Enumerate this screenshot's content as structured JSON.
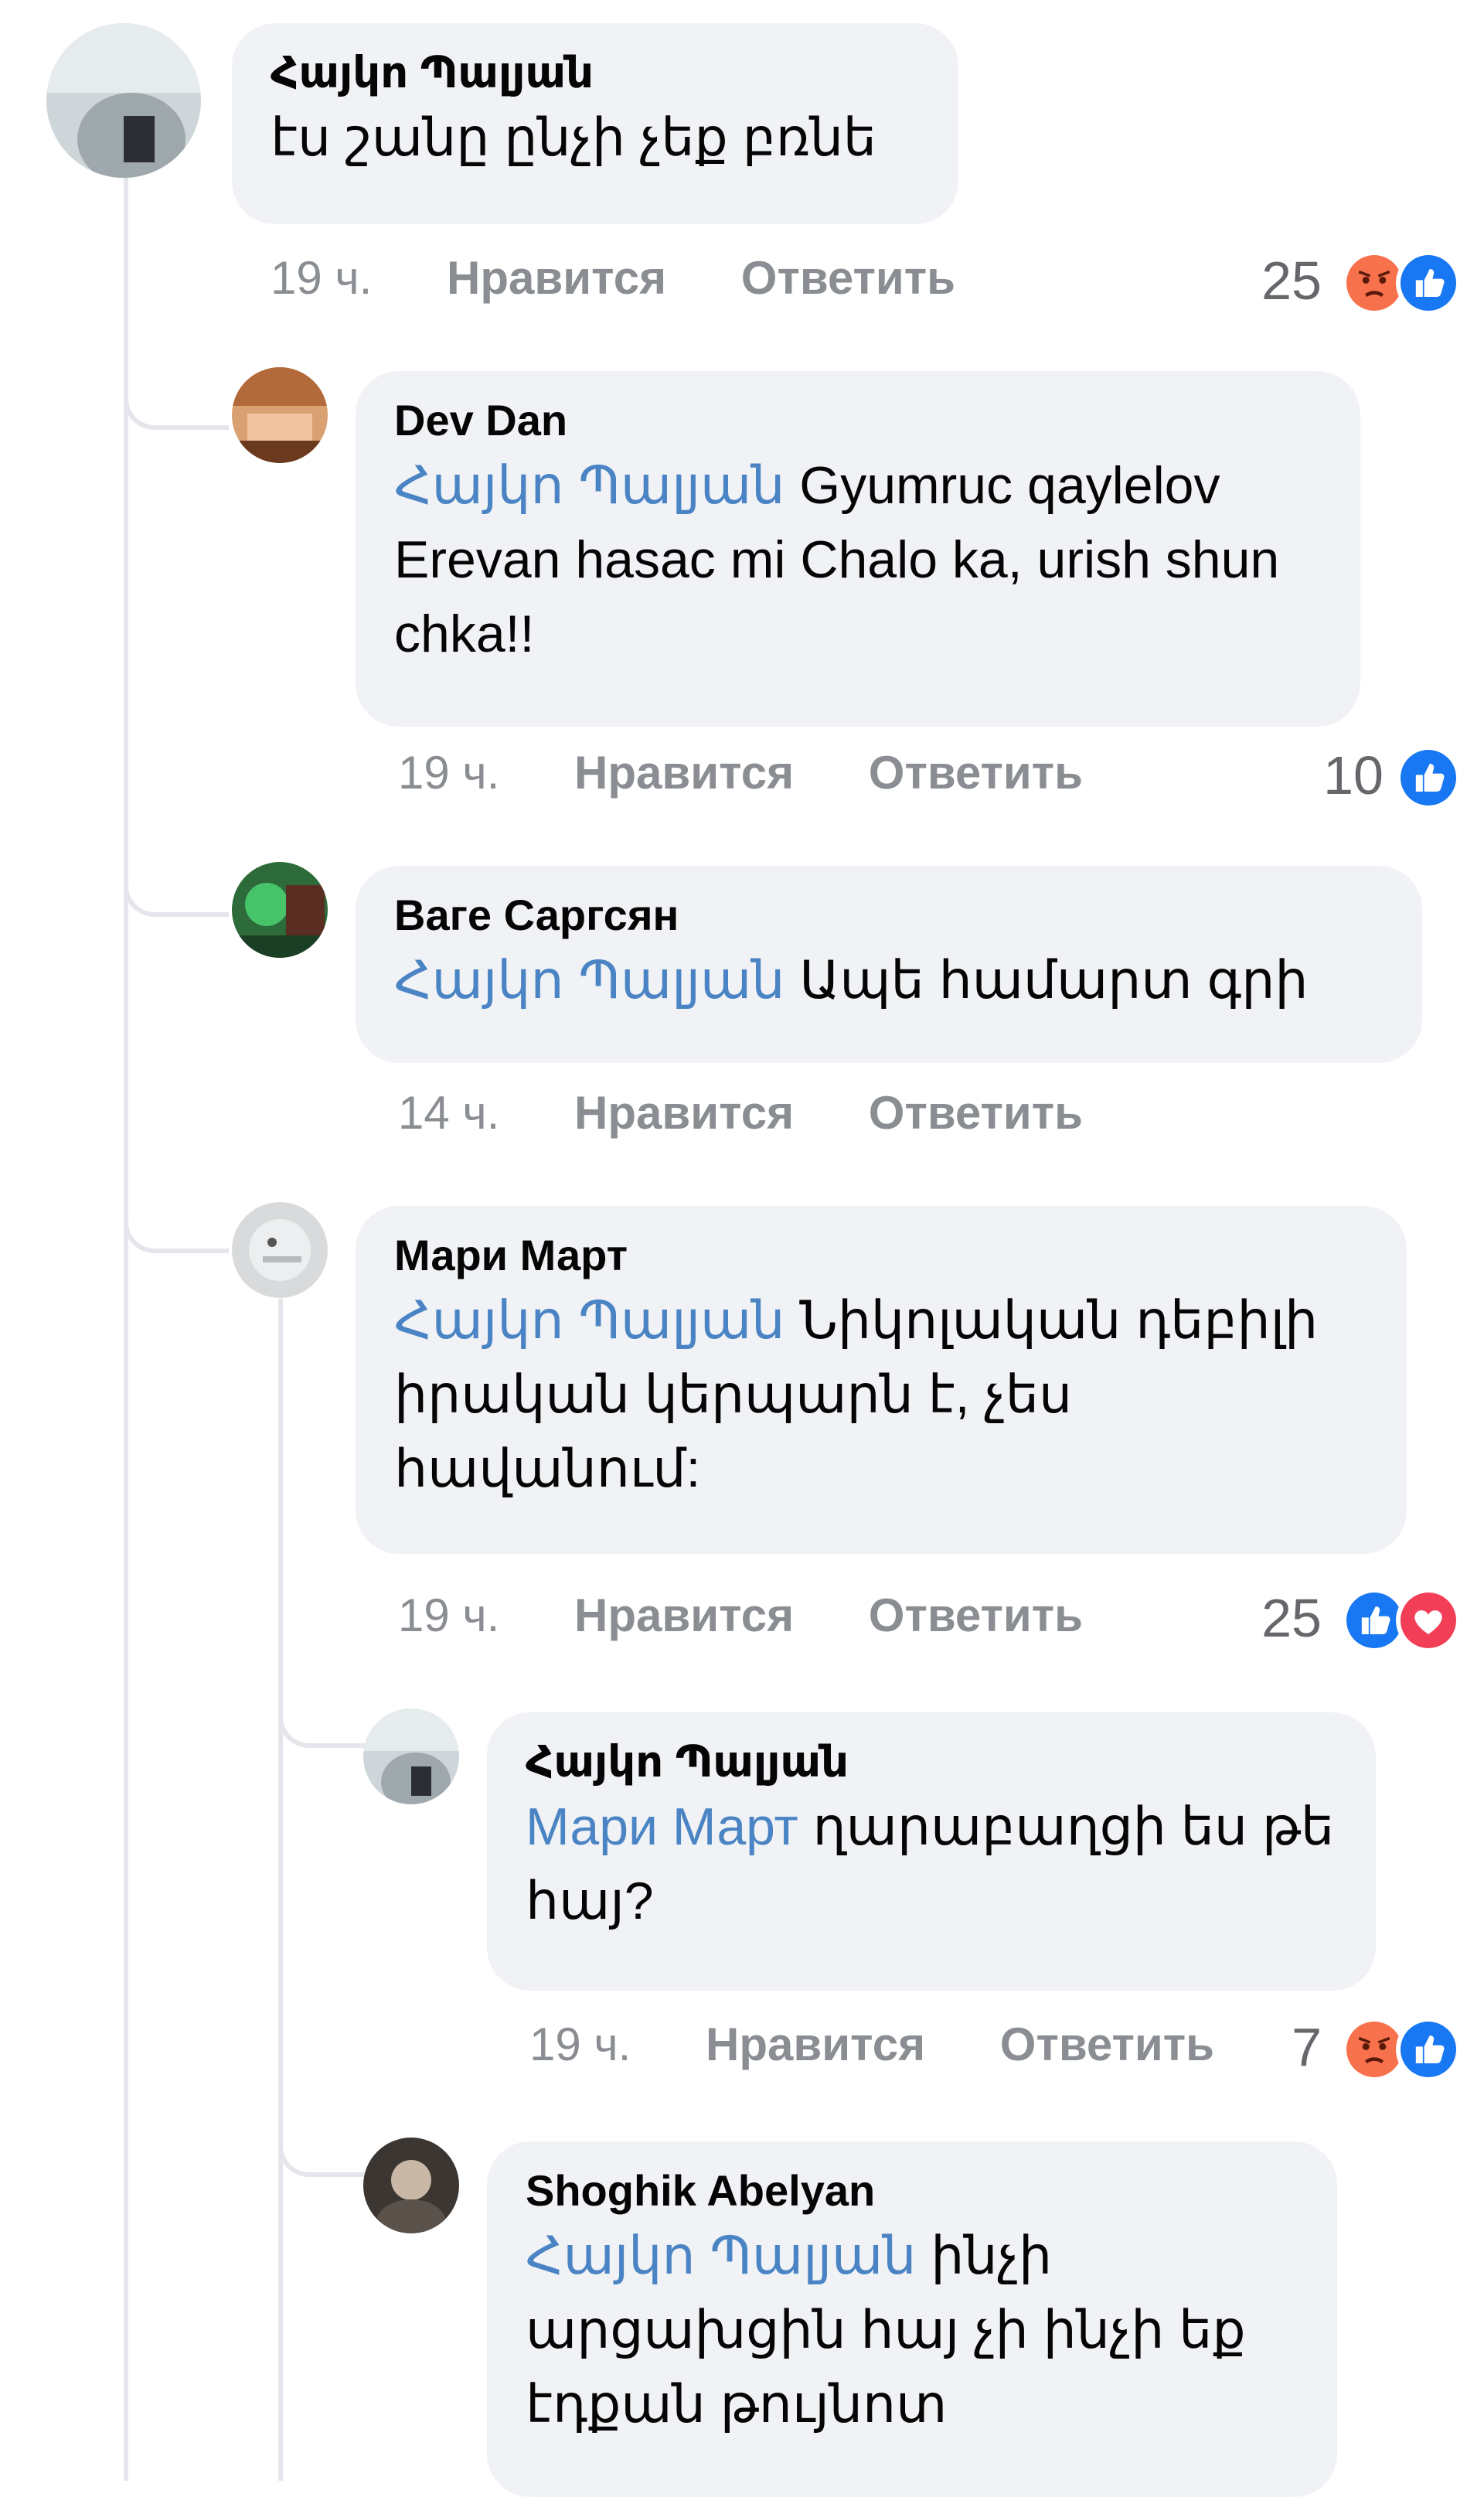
{
  "comments": [
    {
      "author": "Հայկո Պալյան",
      "mention": "",
      "text": "էս շանը ընչի չեք բռնե",
      "time": "19 ч.",
      "like_label": "Нравится",
      "reply_label": "Ответить",
      "reaction_count": "25",
      "reactions": [
        "angry-icon",
        "like-icon"
      ]
    },
    {
      "author": "Dev Dan",
      "mention": "Հայկո Պալյան",
      "text": "Gyumruc qaylelov Erevan hasac mi Chalo ka, urish shun chka!!",
      "time": "19 ч.",
      "like_label": "Нравится",
      "reply_label": "Ответить",
      "reaction_count": "10",
      "reactions": [
        "like-icon"
      ]
    },
    {
      "author": "Ваге Саргсян",
      "mention": "Հայկո Պալյան",
      "text": "Ապե համարտ գրի",
      "time": "14 ч.",
      "like_label": "Нравится",
      "reply_label": "Ответить",
      "reaction_count": "",
      "reactions": []
    },
    {
      "author": "Мари Март",
      "mention": "Հայկո Պալյան",
      "text": "Նիկոլական դեբիլի  իրական կերպարն է, չես հավանում:",
      "time": "19 ч.",
      "like_label": "Нравится",
      "reply_label": "Ответить",
      "reaction_count": "25",
      "reactions": [
        "like-icon",
        "love-icon"
      ]
    },
    {
      "author": "Հայկո Պալյան",
      "mention": "Мари Март",
      "text": "ղարաբաղցի ես թե հայ?",
      "time": "19 ч.",
      "like_label": "Нравится",
      "reply_label": "Ответить",
      "reaction_count": "7",
      "reactions": [
        "angry-icon",
        "like-icon"
      ]
    },
    {
      "author": "Shoghik Abelyan",
      "mention": "Հայկո Պալյան",
      "text": "ինչի արցախցին հայ չի ինչի եք էդքան թույնոտ",
      "time": "",
      "like_label": "",
      "reply_label": "",
      "reaction_count": "",
      "reactions": []
    }
  ],
  "colors": {
    "bubble": "#f0f2f5",
    "mention": "#4a84c4",
    "meta": "#8a8d91",
    "like": "#1877f2",
    "angry": "#f7714c",
    "love": "#f33e58"
  }
}
